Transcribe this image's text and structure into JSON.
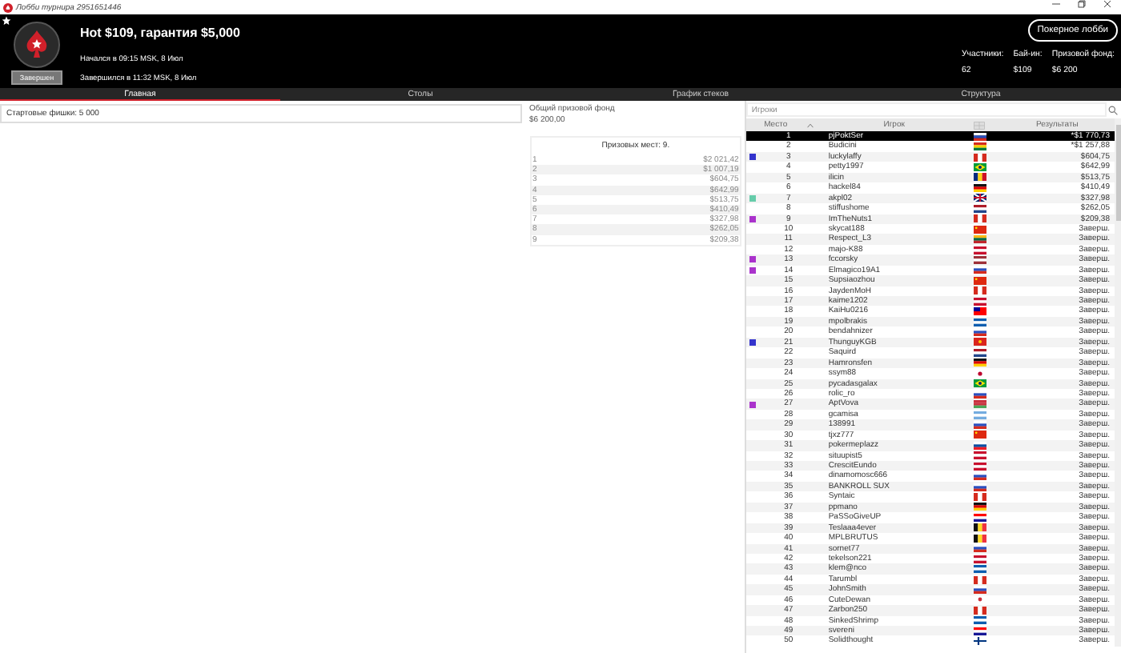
{
  "window": {
    "title": "Лобби турнира 2951651446"
  },
  "tournament": {
    "status": "Завершен",
    "title": "Hot $109, гарантия $5,000",
    "started": "Начался в 09:15 MSK, 8 Июл",
    "finished": "Завершился в 11:32 MSK, 8 Июл",
    "lobby_button": "Покерное лобби",
    "stats": [
      {
        "label": "Участники:",
        "value": "62"
      },
      {
        "label": "Бай-ин:",
        "value": "$109"
      },
      {
        "label": "Призовой фонд:",
        "value": "$6 200"
      }
    ]
  },
  "tabs": [
    {
      "label": "Главная",
      "selected": true
    },
    {
      "label": "Столы",
      "selected": false
    },
    {
      "label": "График стеков",
      "selected": false
    },
    {
      "label": "Структура",
      "selected": false
    }
  ],
  "main": {
    "starting_chips": "Стартовые фишки:  5 000"
  },
  "prizes": {
    "pool_label": "Общий призовой фонд",
    "pool_value": "$6 200,00",
    "places_title": "Призовых мест: 9.",
    "rows": [
      {
        "place": "1",
        "amount": "$2 021,42"
      },
      {
        "place": "2",
        "amount": "$1 007,19"
      },
      {
        "place": "3",
        "amount": "$604,75"
      },
      {
        "place": "4",
        "amount": "$642,99"
      },
      {
        "place": "5",
        "amount": "$513,75"
      },
      {
        "place": "6",
        "amount": "$410,49"
      },
      {
        "place": "7",
        "amount": "$327,98"
      },
      {
        "place": "8",
        "amount": "$262,05"
      },
      {
        "place": "9",
        "amount": "$209,38"
      }
    ]
  },
  "players": {
    "search": {
      "placeholder": "Игроки"
    },
    "columns": [
      "Место",
      "Игрок",
      "Результаты"
    ],
    "rows": [
      {
        "place": "1",
        "name": "pjPoktSer",
        "result": "*$1 770,73",
        "selected": true
      },
      {
        "place": "2",
        "name": "Budicini",
        "result": "*$1 257,88",
        "selected": false
      },
      {
        "place": "3",
        "name": "luckylaffy",
        "result": "$604,75",
        "selected": false,
        "color": "#3333cc"
      },
      {
        "place": "4",
        "name": "petty1997",
        "result": "$642,99",
        "selected": false
      },
      {
        "place": "5",
        "name": "ilicin",
        "result": "$513,75",
        "selected": false
      },
      {
        "place": "6",
        "name": "hackel84",
        "result": "$410,49",
        "selected": false
      },
      {
        "place": "7",
        "name": "akpl02",
        "result": "$327,98",
        "selected": false,
        "color": "#66ccaa"
      },
      {
        "place": "8",
        "name": "stiffushome",
        "result": "$262,05",
        "selected": false
      },
      {
        "place": "9",
        "name": "ImTheNuts1",
        "result": "$209,38",
        "selected": false,
        "color": "#aa33cc"
      },
      {
        "place": "10",
        "name": "skycat188",
        "result": "Заверш.",
        "selected": false
      },
      {
        "place": "11",
        "name": "Respect_L3",
        "result": "Заверш.",
        "selected": false
      },
      {
        "place": "12",
        "name": "majo-K88",
        "result": "Заверш.",
        "selected": false
      },
      {
        "place": "13",
        "name": "fccorsky",
        "result": "Заверш.",
        "selected": false,
        "color": "#aa33cc"
      },
      {
        "place": "14",
        "name": "Elmagico19A1",
        "result": "Заверш.",
        "selected": false,
        "color": "#aa33cc"
      },
      {
        "place": "15",
        "name": "Supsiaozhou",
        "result": "Заверш.",
        "selected": false
      },
      {
        "place": "16",
        "name": "JaydenMoH",
        "result": "Заверш.",
        "selected": false
      },
      {
        "place": "17",
        "name": "kaime1202",
        "result": "Заверш.",
        "selected": false
      },
      {
        "place": "18",
        "name": "KaiHu0216",
        "result": "Заверш.",
        "selected": false
      },
      {
        "place": "19",
        "name": "mpolbrakis",
        "result": "Заверш.",
        "selected": false
      },
      {
        "place": "20",
        "name": "bendahnizer",
        "result": "Заверш.",
        "selected": false
      },
      {
        "place": "21",
        "name": "ThunguyKGB",
        "result": "Заверш.",
        "selected": false,
        "color": "#3333cc"
      },
      {
        "place": "22",
        "name": "Saquird",
        "result": "Заверш.",
        "selected": false
      },
      {
        "place": "23",
        "name": "Hamronsfen",
        "result": "Заверш.",
        "selected": false
      },
      {
        "place": "24",
        "name": "ssym88",
        "result": "Заверш.",
        "selected": false
      },
      {
        "place": "25",
        "name": "pycadasgalax",
        "result": "Заверш.",
        "selected": false
      },
      {
        "place": "26",
        "name": "rolic_ro",
        "result": "Заверш.",
        "selected": false
      },
      {
        "place": "27",
        "name": "AptVova",
        "result": "Заверш.",
        "selected": false,
        "color": "#aa33cc"
      },
      {
        "place": "28",
        "name": "gcamisa",
        "result": "Заверш.",
        "selected": false
      },
      {
        "place": "29",
        "name": "138991",
        "result": "Заверш.",
        "selected": false
      },
      {
        "place": "30",
        "name": "tjxz777",
        "result": "Заверш.",
        "selected": false
      },
      {
        "place": "31",
        "name": "pokermeplazz",
        "result": "Заверш.",
        "selected": false
      },
      {
        "place": "32",
        "name": "situupist5",
        "result": "Заверш.",
        "selected": false
      },
      {
        "place": "33",
        "name": "CrescitEundo",
        "result": "Заверш.",
        "selected": false
      },
      {
        "place": "34",
        "name": "dinamomosc666",
        "result": "Заверш.",
        "selected": false
      },
      {
        "place": "35",
        "name": "BANKROLL SUX",
        "result": "Заверш.",
        "selected": false
      },
      {
        "place": "36",
        "name": "Syntaic",
        "result": "Заверш.",
        "selected": false
      },
      {
        "place": "37",
        "name": "ppmano",
        "result": "Заверш.",
        "selected": false
      },
      {
        "place": "38",
        "name": "PaSSoGiveUP",
        "result": "Заверш.",
        "selected": false
      },
      {
        "place": "39",
        "name": "Teslaaa4ever",
        "result": "Заверш.",
        "selected": false
      },
      {
        "place": "40",
        "name": "MPLBRUTUS",
        "result": "Заверш.",
        "selected": false
      },
      {
        "place": "41",
        "name": "sornet77",
        "result": "Заверш.",
        "selected": false
      },
      {
        "place": "42",
        "name": "tekelson221",
        "result": "Заверш.",
        "selected": false
      },
      {
        "place": "43",
        "name": "klem@nco",
        "result": "Заверш.",
        "selected": false
      },
      {
        "place": "44",
        "name": "Tarumbl",
        "result": "Заверш.",
        "selected": false
      },
      {
        "place": "45",
        "name": "JohnSmith",
        "result": "Заверш.",
        "selected": false
      },
      {
        "place": "46",
        "name": "CuteDewan",
        "result": "Заверш.",
        "selected": false
      },
      {
        "place": "47",
        "name": "Zarbon250",
        "result": "Заверш.",
        "selected": false
      },
      {
        "place": "48",
        "name": "SinkedShrimp",
        "result": "Заверш.",
        "selected": false
      },
      {
        "place": "49",
        "name": "svereni",
        "result": "Заверш.",
        "selected": false
      },
      {
        "place": "50",
        "name": "Solidthought",
        "result": "Заверш.",
        "selected": false
      }
    ]
  }
}
